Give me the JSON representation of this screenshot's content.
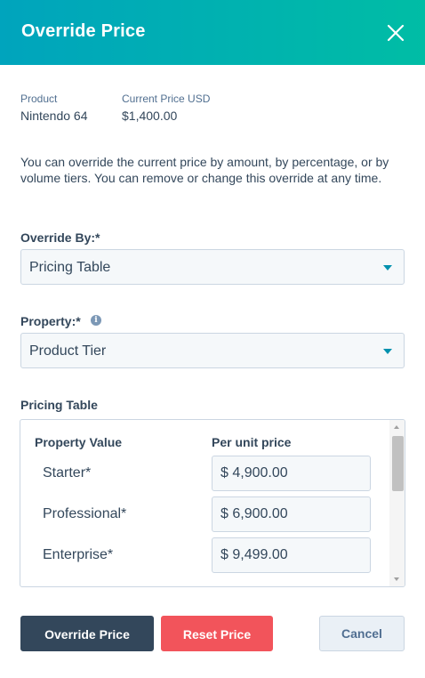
{
  "header": {
    "title": "Override Price"
  },
  "product": {
    "label": "Product",
    "value": "Nintendo 64",
    "price_label": "Current Price USD",
    "price_value": "$1,400.00"
  },
  "description": "You can override the current price by amount, by percentage, or by volume tiers. You can remove or change this override at any time.",
  "override_by": {
    "label": "Override By:*",
    "value": "Pricing Table"
  },
  "property": {
    "label": "Property:*",
    "value": "Product Tier",
    "info_icon": "i"
  },
  "pricing_table": {
    "label": "Pricing Table",
    "columns": [
      "Property Value",
      "Per unit price"
    ],
    "rows": [
      {
        "label": "Starter*",
        "price": "$ 4,900.00"
      },
      {
        "label": "Professional*",
        "price": "$ 6,900.00"
      },
      {
        "label": "Enterprise*",
        "price": "$ 9,499.00"
      }
    ]
  },
  "buttons": {
    "override": "Override Price",
    "reset": "Reset Price",
    "cancel": "Cancel"
  },
  "colors": {
    "header_gradient_start": "#00a4bd",
    "header_gradient_end": "#00bda5",
    "primary_button": "#33475b",
    "danger_button": "#f2545b",
    "secondary_button": "#eaf0f6",
    "caret": "#0091ae"
  },
  "icons": [
    "close-icon",
    "info-icon",
    "chevron-down-icon"
  ]
}
